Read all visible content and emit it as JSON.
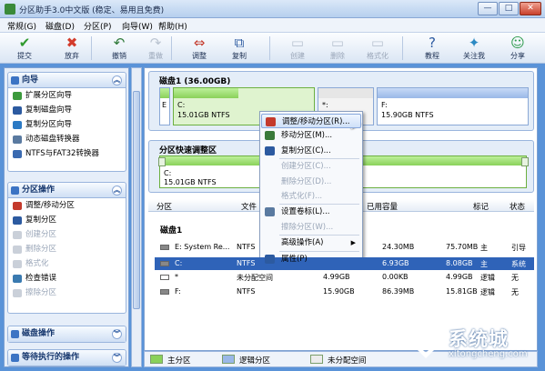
{
  "window": {
    "title": "分区助手3.0中文版 (稳定、易用且免费)",
    "minimize": "—",
    "maximize": "□",
    "close": "✕"
  },
  "menu": [
    "常规(G)",
    "磁盘(D)",
    "分区(P)",
    "向导(W)",
    "帮助(H)"
  ],
  "toolbar": [
    {
      "label": "提交",
      "icon": "check-icon",
      "glyph": "✔",
      "color": "#2f9a2f",
      "enabled": true
    },
    {
      "label": "放弃",
      "icon": "cross-icon",
      "glyph": "✖",
      "color": "#d33c2c",
      "enabled": true
    },
    {
      "label": "撤销",
      "icon": "undo-icon",
      "glyph": "↶",
      "color": "#2f7a3a",
      "enabled": true
    },
    {
      "label": "重做",
      "icon": "redo-icon",
      "glyph": "↷",
      "color": "#7a8aa0",
      "enabled": false
    },
    {
      "label": "调整",
      "icon": "resize-icon",
      "glyph": "⇔",
      "color": "#c43a2c",
      "enabled": true
    },
    {
      "label": "复制",
      "icon": "copy-disk-icon",
      "glyph": "⧉",
      "color": "#2c5aa0",
      "enabled": true
    },
    {
      "label": "创建",
      "icon": "create-icon",
      "glyph": "▭",
      "color": "#7a8aa0",
      "enabled": false
    },
    {
      "label": "删除",
      "icon": "delete-icon",
      "glyph": "▭",
      "color": "#7a8aa0",
      "enabled": false
    },
    {
      "label": "格式化",
      "icon": "format-icon",
      "glyph": "▭",
      "color": "#7a8aa0",
      "enabled": false
    },
    {
      "label": "教程",
      "icon": "help-icon",
      "glyph": "?",
      "color": "#2c5aa0",
      "enabled": true
    },
    {
      "label": "关注我",
      "icon": "follow-icon",
      "glyph": "✦",
      "color": "#2c8ac4",
      "enabled": true
    },
    {
      "label": "分享",
      "icon": "share-icon",
      "glyph": "☺",
      "color": "#2c9a4a",
      "enabled": true
    }
  ],
  "sidebar": {
    "wizard": {
      "title": "向导",
      "items": [
        "扩展分区向导",
        "复制磁盘向导",
        "复制分区向导",
        "动态磁盘转换器",
        "NTFS与FAT32转换器"
      ]
    },
    "partition_ops": {
      "title": "分区操作",
      "items": [
        {
          "label": "调整/移动分区",
          "enabled": true
        },
        {
          "label": "复制分区",
          "enabled": true
        },
        {
          "label": "创建分区",
          "enabled": false
        },
        {
          "label": "删除分区",
          "enabled": false
        },
        {
          "label": "格式化",
          "enabled": false
        },
        {
          "label": "检查错误",
          "enabled": true
        },
        {
          "label": "擦除分区",
          "enabled": false
        }
      ]
    },
    "disk_ops": {
      "title": "磁盘操作"
    },
    "pending": {
      "title": "等待执行的操作"
    }
  },
  "disk": {
    "label": "磁盘1 (36.00GB)",
    "partitions": [
      {
        "letter": "E",
        "info": "",
        "used": 0.9
      },
      {
        "letter": "C:",
        "info": "15.01GB NTFS",
        "used": 0.46
      },
      {
        "letter": "*:",
        "info": "",
        "used": 0
      },
      {
        "letter": "F:",
        "info": "15.90GB NTFS",
        "used": 0.005
      }
    ]
  },
  "quick": {
    "label": "分区快速调整区",
    "part_letter": "C:",
    "part_info": "15.01GB NTFS"
  },
  "table": {
    "columns": [
      "分区",
      "文件",
      "已用容量",
      "标记",
      "状态"
    ],
    "disk_row": "磁盘1",
    "rows": [
      {
        "name": "E:   System Re...",
        "fs": "NTFS",
        "used": "24.30MB",
        "free": "75.70MB",
        "type": "主",
        "status": "引导"
      },
      {
        "name": "C:",
        "fs": "NTFS",
        "used": "6.93GB",
        "free": "8.08GB",
        "type": "主",
        "status": "系统"
      },
      {
        "name": "*",
        "fs": "未分配空间",
        "cap": "4.99GB",
        "used": "0.00KB",
        "free": "4.99GB",
        "type": "逻辑",
        "status": "无"
      },
      {
        "name": "F:",
        "fs": "NTFS",
        "cap": "15.90GB",
        "used": "86.39MB",
        "free": "15.81GB",
        "type": "逻辑",
        "status": "无"
      }
    ]
  },
  "legend": [
    {
      "label": "主分区",
      "color": "#8ad15a"
    },
    {
      "label": "逻辑分区",
      "color": "#9ab8e8"
    },
    {
      "label": "未分配空间",
      "color": "#ececec"
    }
  ],
  "context_menu": [
    {
      "label": "调整/移动分区(R)...",
      "enabled": true,
      "highlight": true,
      "icon": "resize-icon",
      "color": "#c43a2c"
    },
    {
      "label": "移动分区(M)...",
      "enabled": true,
      "icon": "move-icon",
      "color": "#3a7a3a"
    },
    {
      "label": "复制分区(C)...",
      "enabled": true,
      "icon": "copy-icon",
      "color": "#2c5aa0"
    },
    {
      "label": "创建分区(C)...",
      "enabled": false,
      "sep": true
    },
    {
      "label": "删除分区(D)...",
      "enabled": false
    },
    {
      "label": "格式化(F)...",
      "enabled": false
    },
    {
      "label": "设置卷标(L)...",
      "enabled": true,
      "sep": true,
      "icon": "label-icon",
      "color": "#5a7aa0"
    },
    {
      "label": "擦除分区(W)...",
      "enabled": false
    },
    {
      "label": "高级操作(A)",
      "enabled": true,
      "sep": true,
      "submenu": "▶"
    },
    {
      "label": "属性(P)",
      "enabled": true,
      "sep": true,
      "icon": "properties-icon",
      "color": "#2c5aa0"
    }
  ],
  "watermark": {
    "text": "系统城",
    "url": "xitongcheng.com"
  }
}
